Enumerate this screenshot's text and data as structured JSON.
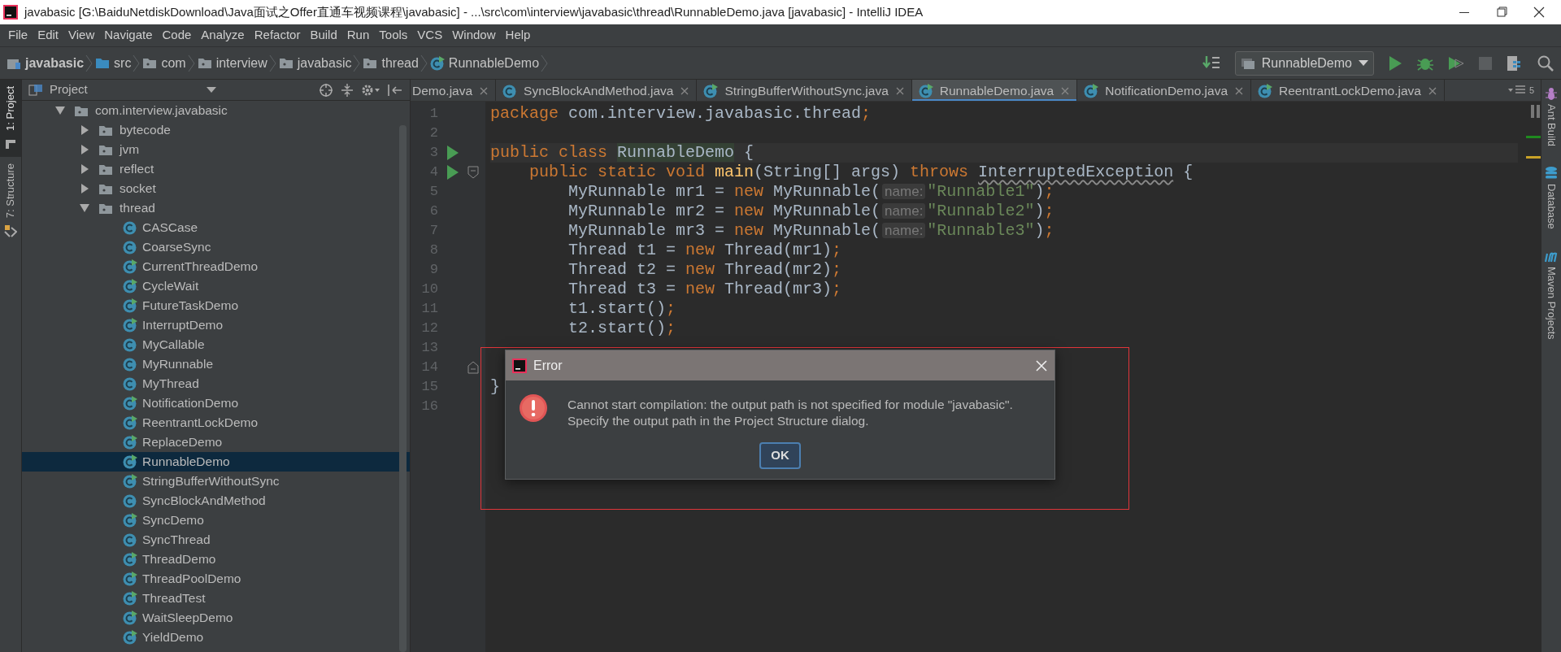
{
  "window": {
    "title": "javabasic [G:\\BaiduNetdiskDownload\\Java面试之Offer直通车视频课程\\javabasic] - ...\\src\\com\\interview\\javabasic\\thread\\RunnableDemo.java [javabasic] - IntelliJ IDEA"
  },
  "menu": [
    "File",
    "Edit",
    "View",
    "Navigate",
    "Code",
    "Analyze",
    "Refactor",
    "Build",
    "Run",
    "Tools",
    "VCS",
    "Window",
    "Help"
  ],
  "breadcrumbs": [
    {
      "label": "javabasic",
      "kind": "module"
    },
    {
      "label": "src",
      "kind": "source"
    },
    {
      "label": "com",
      "kind": "folder"
    },
    {
      "label": "interview",
      "kind": "folder"
    },
    {
      "label": "javabasic",
      "kind": "folder"
    },
    {
      "label": "thread",
      "kind": "folder"
    },
    {
      "label": "RunnableDemo",
      "kind": "class"
    }
  ],
  "run_config": {
    "label": "RunnableDemo"
  },
  "left_tool_windows": [
    {
      "label": "1: Project",
      "selected": true
    },
    {
      "label": "7: Structure",
      "selected": false
    }
  ],
  "right_tool_windows": [
    {
      "label": "Ant Build",
      "kind": "ant"
    },
    {
      "label": "Database",
      "kind": "database"
    },
    {
      "label": "Maven Projects",
      "kind": "maven"
    }
  ],
  "project_panel": {
    "title": "Project",
    "tree": [
      {
        "label": "com.interview.javabasic",
        "kind": "package",
        "expanded": true,
        "selected": false,
        "children": [
          {
            "label": "bytecode",
            "kind": "package",
            "expanded": false,
            "selected": false
          },
          {
            "label": "jvm",
            "kind": "package",
            "expanded": false,
            "selected": false
          },
          {
            "label": "reflect",
            "kind": "package",
            "expanded": false,
            "selected": false
          },
          {
            "label": "socket",
            "kind": "package",
            "expanded": false,
            "selected": false
          },
          {
            "label": "thread",
            "kind": "package",
            "expanded": true,
            "selected": false,
            "children": [
              {
                "label": "CASCase",
                "kind": "class",
                "runnable": false,
                "selected": false
              },
              {
                "label": "CoarseSync",
                "kind": "class",
                "runnable": false,
                "selected": false
              },
              {
                "label": "CurrentThreadDemo",
                "kind": "class",
                "runnable": true,
                "selected": false
              },
              {
                "label": "CycleWait",
                "kind": "class",
                "runnable": true,
                "selected": false
              },
              {
                "label": "FutureTaskDemo",
                "kind": "class",
                "runnable": true,
                "selected": false
              },
              {
                "label": "InterruptDemo",
                "kind": "class",
                "runnable": true,
                "selected": false
              },
              {
                "label": "MyCallable",
                "kind": "class",
                "runnable": false,
                "selected": false
              },
              {
                "label": "MyRunnable",
                "kind": "class",
                "runnable": false,
                "selected": false
              },
              {
                "label": "MyThread",
                "kind": "class",
                "runnable": false,
                "selected": false
              },
              {
                "label": "NotificationDemo",
                "kind": "class",
                "runnable": true,
                "selected": false
              },
              {
                "label": "ReentrantLockDemo",
                "kind": "class",
                "runnable": true,
                "selected": false
              },
              {
                "label": "ReplaceDemo",
                "kind": "class",
                "runnable": true,
                "selected": false
              },
              {
                "label": "RunnableDemo",
                "kind": "class",
                "runnable": true,
                "selected": true
              },
              {
                "label": "StringBufferWithoutSync",
                "kind": "class",
                "runnable": true,
                "selected": false
              },
              {
                "label": "SyncBlockAndMethod",
                "kind": "class",
                "runnable": false,
                "selected": false
              },
              {
                "label": "SyncDemo",
                "kind": "class",
                "runnable": true,
                "selected": false
              },
              {
                "label": "SyncThread",
                "kind": "class",
                "runnable": false,
                "selected": false
              },
              {
                "label": "ThreadDemo",
                "kind": "class",
                "runnable": true,
                "selected": false
              },
              {
                "label": "ThreadPoolDemo",
                "kind": "class",
                "runnable": true,
                "selected": false
              },
              {
                "label": "ThreadTest",
                "kind": "class",
                "runnable": true,
                "selected": false
              },
              {
                "label": "WaitSleepDemo",
                "kind": "class",
                "runnable": true,
                "selected": false
              },
              {
                "label": "YieldDemo",
                "kind": "class",
                "runnable": true,
                "selected": false
              }
            ]
          }
        ]
      }
    ]
  },
  "editor_tabs": [
    {
      "label": "Demo.java",
      "kind": "cut",
      "selected": false
    },
    {
      "label": "SyncBlockAndMethod.java",
      "kind": "class",
      "selected": false
    },
    {
      "label": "StringBufferWithoutSync.java",
      "kind": "runnable",
      "selected": false
    },
    {
      "label": "RunnableDemo.java",
      "kind": "runnable",
      "selected": true
    },
    {
      "label": "NotificationDemo.java",
      "kind": "runnable",
      "selected": false
    },
    {
      "label": "ReentrantLockDemo.java",
      "kind": "runnable",
      "selected": false
    }
  ],
  "hidden_tabs_count": "5",
  "code_lines": [
    {
      "number": "1",
      "tokens": [
        {
          "kind": "kw",
          "text": "package"
        },
        {
          "kind": "plain",
          "text": " com.interview.javabasic.thread"
        },
        {
          "kind": "semi",
          "text": ";"
        }
      ]
    },
    {
      "number": "2"
    },
    {
      "number": "3",
      "current": true,
      "run": true,
      "tokens": [
        {
          "kind": "kw",
          "text": "public class "
        },
        {
          "kind": "cls",
          "text": "RunnableDemo"
        },
        {
          "kind": "plain",
          "text": " {"
        }
      ]
    },
    {
      "number": "4",
      "run": true,
      "fold_start": true,
      "tokens": [
        {
          "kind": "kw",
          "text": "    public static void "
        },
        {
          "kind": "fn",
          "text": "main"
        },
        {
          "kind": "plain",
          "text": "(String[] args) "
        },
        {
          "kind": "kw",
          "text": "throws "
        },
        {
          "kind": "warn",
          "text": "InterruptedException"
        },
        {
          "kind": "plain",
          "text": " {"
        }
      ]
    },
    {
      "number": "5",
      "tokens": [
        {
          "kind": "plain",
          "text": "        MyRunnable mr1 = "
        },
        {
          "kind": "kw",
          "text": "new"
        },
        {
          "kind": "plain",
          "text": " MyRunnable("
        },
        {
          "kind": "hint",
          "text": "name:"
        },
        {
          "kind": "str",
          "text": "\"Runnable1\""
        },
        {
          "kind": "plain",
          "text": ")"
        },
        {
          "kind": "semi",
          "text": ";"
        }
      ]
    },
    {
      "number": "6",
      "tokens": [
        {
          "kind": "plain",
          "text": "        MyRunnable mr2 = "
        },
        {
          "kind": "kw",
          "text": "new"
        },
        {
          "kind": "plain",
          "text": " MyRunnable("
        },
        {
          "kind": "hint",
          "text": "name:"
        },
        {
          "kind": "str",
          "text": "\"Runnable2\""
        },
        {
          "kind": "plain",
          "text": ")"
        },
        {
          "kind": "semi",
          "text": ";"
        }
      ]
    },
    {
      "number": "7",
      "tokens": [
        {
          "kind": "plain",
          "text": "        MyRunnable mr3 = "
        },
        {
          "kind": "kw",
          "text": "new"
        },
        {
          "kind": "plain",
          "text": " MyRunnable("
        },
        {
          "kind": "hint",
          "text": "name:"
        },
        {
          "kind": "str",
          "text": "\"Runnable3\""
        },
        {
          "kind": "plain",
          "text": ")"
        },
        {
          "kind": "semi",
          "text": ";"
        }
      ]
    },
    {
      "number": "8",
      "tokens": [
        {
          "kind": "plain",
          "text": "        Thread t1 = "
        },
        {
          "kind": "kw",
          "text": "new"
        },
        {
          "kind": "plain",
          "text": " Thread(mr1)"
        },
        {
          "kind": "semi",
          "text": ";"
        }
      ]
    },
    {
      "number": "9",
      "tokens": [
        {
          "kind": "plain",
          "text": "        Thread t2 = "
        },
        {
          "kind": "kw",
          "text": "new"
        },
        {
          "kind": "plain",
          "text": " Thread(mr2)"
        },
        {
          "kind": "semi",
          "text": ";"
        }
      ]
    },
    {
      "number": "10",
      "tokens": [
        {
          "kind": "plain",
          "text": "        Thread t3 = "
        },
        {
          "kind": "kw",
          "text": "new"
        },
        {
          "kind": "plain",
          "text": " Thread(mr3)"
        },
        {
          "kind": "semi",
          "text": ";"
        }
      ]
    },
    {
      "number": "11",
      "tokens": [
        {
          "kind": "plain",
          "text": "        t1.start()"
        },
        {
          "kind": "semi",
          "text": ";"
        }
      ]
    },
    {
      "number": "12",
      "tokens": [
        {
          "kind": "plain",
          "text": "        t2.start()"
        },
        {
          "kind": "semi",
          "text": ";"
        }
      ]
    },
    {
      "number": "13"
    },
    {
      "number": "14",
      "fold_end": true
    },
    {
      "number": "15",
      "tokens": [
        {
          "kind": "plain",
          "text": "}"
        }
      ]
    },
    {
      "number": "16"
    }
  ],
  "dialog": {
    "title": "Error",
    "message_lines": [
      "Cannot start compilation: the output path is not specified for module \"javabasic\".",
      "Specify the output path in the Project Structure dialog."
    ],
    "button": "OK"
  }
}
